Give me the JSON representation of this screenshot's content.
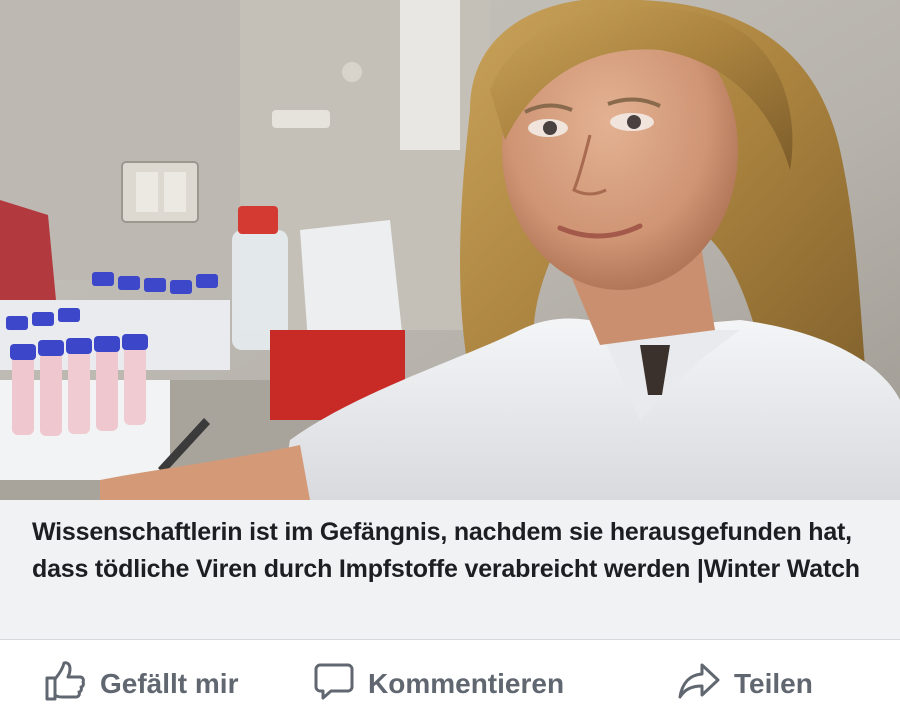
{
  "post": {
    "link_title": "Wissenschaftlerin ist im Gefängnis, nachdem sie herausgefunden hat, dass tödliche Viren durch Impfstoffe verabreicht werden |Winter Watch"
  },
  "actions": {
    "like_label": "Gefällt mir",
    "comment_label": "Kommentieren",
    "share_label": "Teilen",
    "like_icon": "thumbs-up-icon",
    "comment_icon": "speech-bubble-icon",
    "share_icon": "share-arrow-icon"
  },
  "colors": {
    "caption_background": "#f1f2f4",
    "title_text": "#1c1e21",
    "action_text": "#606770"
  }
}
